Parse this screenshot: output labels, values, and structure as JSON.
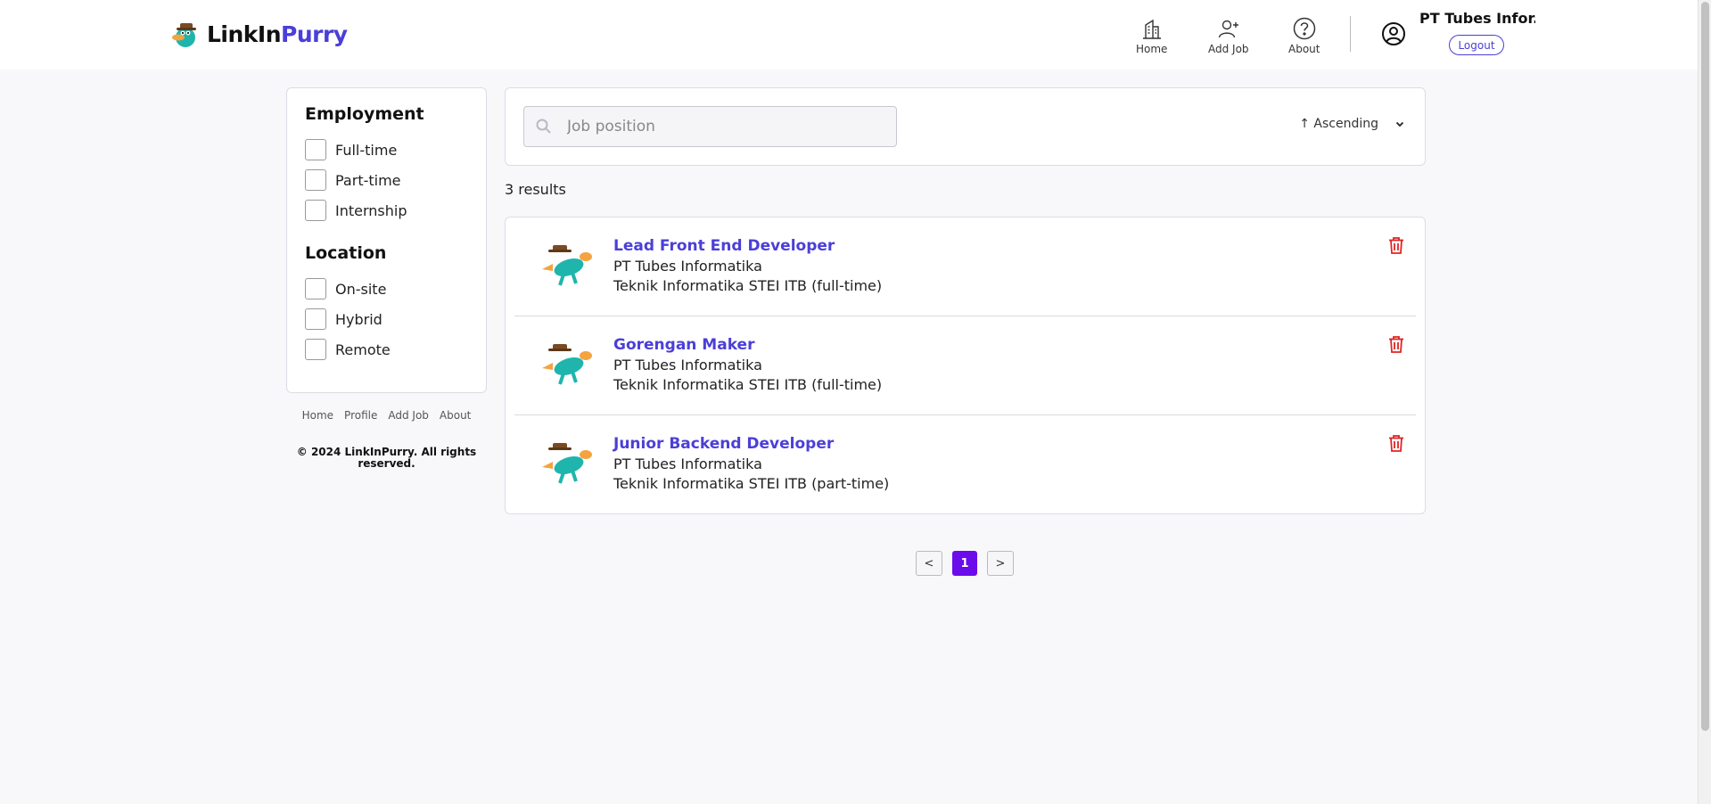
{
  "header": {
    "logo": {
      "part1": "LinkIn",
      "part2": "Purry"
    },
    "nav": [
      {
        "label": "Home",
        "icon": "building-icon"
      },
      {
        "label": "Add Job",
        "icon": "add-user-icon"
      },
      {
        "label": "About",
        "icon": "question-icon"
      }
    ],
    "user": {
      "name": "PT Tubes Infor...",
      "logout_label": "Logout"
    }
  },
  "filters": {
    "employment": {
      "title": "Employment",
      "options": [
        "Full-time",
        "Part-time",
        "Internship"
      ]
    },
    "location": {
      "title": "Location",
      "options": [
        "On-site",
        "Hybrid",
        "Remote"
      ]
    }
  },
  "footer": {
    "links": [
      "Home",
      "Profile",
      "Add Job",
      "About"
    ],
    "copyright": "© 2024 LinkInPurry. All rights reserved."
  },
  "search": {
    "placeholder": "Job position",
    "value": "",
    "sort_label": "↑ Ascending"
  },
  "results": {
    "count_text": "3 results"
  },
  "jobs": [
    {
      "title": "Lead Front End Developer",
      "company": "PT Tubes Informatika",
      "location": "Teknik Informatika STEI ITB (full-time)"
    },
    {
      "title": "Gorengan Maker",
      "company": "PT Tubes Informatika",
      "location": "Teknik Informatika STEI ITB (full-time)"
    },
    {
      "title": "Junior Backend Developer",
      "company": "PT Tubes Informatika",
      "location": "Teknik Informatika STEI ITB (part-time)"
    }
  ],
  "pagination": {
    "prev": "<",
    "current": "1",
    "next": ">"
  },
  "colors": {
    "accent": "#4b3fd8",
    "page_active": "#6a0dea",
    "delete": "#e02424",
    "mascot": "#1fb5ad"
  }
}
